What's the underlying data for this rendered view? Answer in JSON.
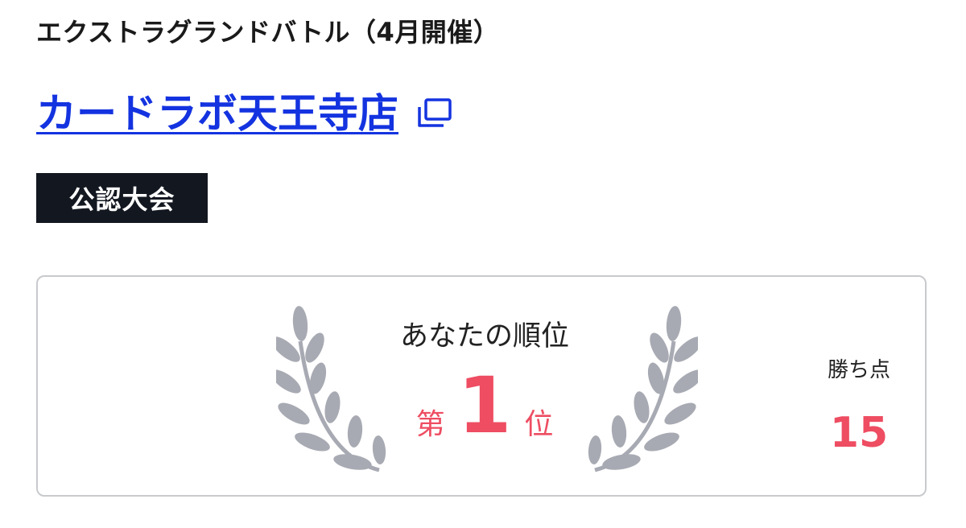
{
  "event": {
    "title": "エクストラグランドバトル（4月開催）"
  },
  "store": {
    "name": "カードラボ天王寺店",
    "link_icon": "external-link-icon"
  },
  "badge": {
    "label": "公認大会"
  },
  "result": {
    "heading": "あなたの順位",
    "rank_prefix": "第",
    "rank_number": "1",
    "rank_suffix": "位",
    "points_label": "勝ち点",
    "points_value": "15",
    "decoration_icon": "laurel-wreath-icon"
  },
  "colors": {
    "link": "#1433e0",
    "badge_bg": "#131720",
    "accent": "#ee4d62",
    "laurel": "#a8aab3",
    "card_border": "#c8cacd"
  }
}
